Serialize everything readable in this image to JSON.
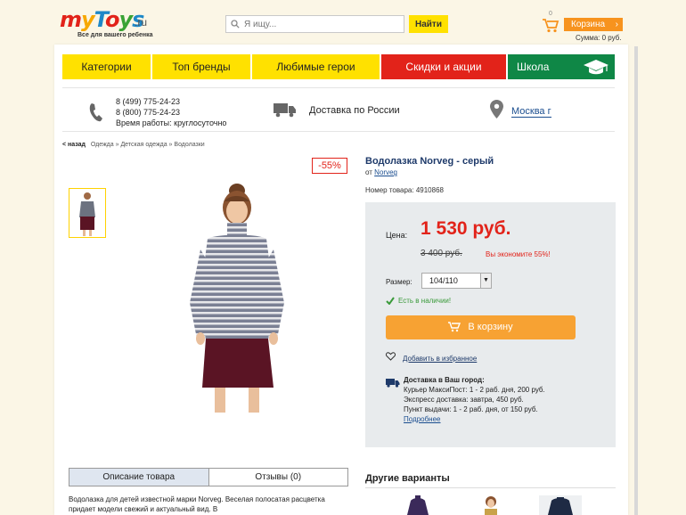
{
  "header": {
    "logo_sub": "Все для вашего ребенка",
    "logo_tld": ".ru",
    "search_placeholder": "Я ищу...",
    "search_button": "Найти",
    "cart_count": "0",
    "cart_label": "Корзина",
    "cart_sum": "Сумма: 0 руб."
  },
  "nav": [
    "Категории",
    "Топ бренды",
    "Любимые герои",
    "Скидки и акции",
    "Школа"
  ],
  "info": {
    "phone1": "8 (499) 775-24-23",
    "phone2": "8 (800) 775-24-23",
    "hours": "Время работы: круглосуточно",
    "delivery": "Доставка по России",
    "city": "Москва г"
  },
  "breadcrumb": {
    "back": "< назад",
    "path": "Одежда » Детская одежда » Водолазки"
  },
  "product": {
    "discount": "-55%",
    "title": "Водолазка Norveg - серый",
    "by_prefix": "от",
    "brand": "Norveg",
    "sku": "Номер товара: 4910868",
    "price_label": "Цена:",
    "price": "1 530 руб.",
    "old_price": "3 400 руб.",
    "save": "Вы экономите 55%!",
    "size_label": "Размер:",
    "size_value": "104/110",
    "stock": "Есть в наличии!",
    "add_to_cart": "В корзину",
    "favorite": "Добавить в избранное",
    "delivery_title": "Доставка в Ваш город:",
    "delivery_lines": [
      "Курьер МаксиПост: 1 - 2 раб. дня, 200 руб.",
      "Экспресс доставка: завтра, 450 руб.",
      "Пункт выдачи: 1 - 2 раб. дня, от 150 руб."
    ],
    "more": "Подробнее"
  },
  "tabs": [
    "Описание товара",
    "Отзывы (0)"
  ],
  "description": "Водолазка для детей известной марки Norveg. Веселая полосатая расцветка придает модели свежий и актуальный вид. В",
  "others_title": "Другие варианты",
  "colors": {
    "yellow": "#ffe100",
    "red": "#e2231a",
    "green": "#0f8746",
    "orange": "#f7a233",
    "navy": "#1e3a6a"
  }
}
